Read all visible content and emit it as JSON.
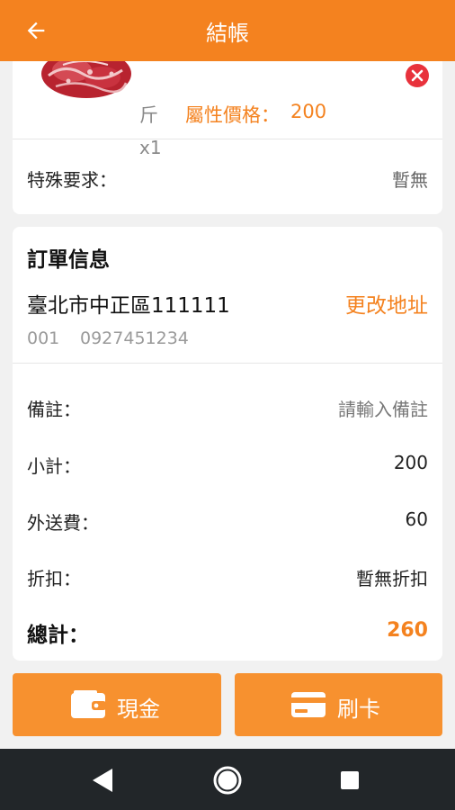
{
  "appbar": {
    "title": "結帳",
    "back_icon": "arrow-left-icon"
  },
  "item": {
    "unit": "斤",
    "attr_label": "屬性價格：",
    "attr_value": "200",
    "quantity": "x1",
    "image_icon": "meat-image",
    "remove_icon": "close-circle-icon"
  },
  "special": {
    "label": "特殊要求：",
    "value": "暫無"
  },
  "order": {
    "title": "訂單信息",
    "address": "臺北市中正區111111",
    "change_address": "更改地址",
    "contact_id": "001",
    "contact_phone": "0927451234",
    "note_label": "備註：",
    "note_placeholder": "請輸入備註",
    "subtotal_label": "小計：",
    "subtotal_value": "200",
    "delivery_label": "外送費：",
    "delivery_value": "60",
    "discount_label": "折扣：",
    "discount_value": "暫無折扣",
    "total_label": "總計：",
    "total_value": "260"
  },
  "payment": {
    "cash_label": "現金",
    "card_label": "刷卡",
    "cash_icon": "wallet-icon",
    "card_icon": "credit-card-icon"
  },
  "colors": {
    "accent": "#f4821f",
    "danger": "#e8323c",
    "nav_bg": "#222629"
  }
}
